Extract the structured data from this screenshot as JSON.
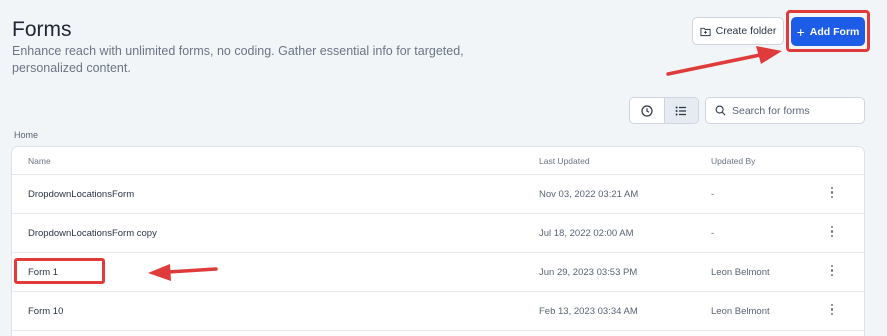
{
  "header": {
    "title": "Forms",
    "subtitle": "Enhance reach with unlimited forms, no coding. Gather essential info for targeted, personalized content.",
    "create_folder_label": "Create folder",
    "add_form_label": "Add Form"
  },
  "toolbar": {
    "search_placeholder": "Search for forms",
    "view_icons": [
      "clock-icon",
      "list-icon"
    ]
  },
  "breadcrumb": "Home",
  "table": {
    "columns": [
      "Name",
      "Last Updated",
      "Updated By"
    ],
    "rows": [
      {
        "name": "DropdownLocationsForm",
        "last_updated": "Nov 03, 2022 03:21 AM",
        "updated_by": "-"
      },
      {
        "name": "DropdownLocationsForm copy",
        "last_updated": "Jul 18, 2022 02:00 AM",
        "updated_by": "-"
      },
      {
        "name": "Form 1",
        "last_updated": "Jun 29, 2023 03:53 PM",
        "updated_by": "Leon Belmont"
      },
      {
        "name": "Form 10",
        "last_updated": "Feb 13, 2023 03:34 AM",
        "updated_by": "Leon Belmont"
      }
    ]
  },
  "colors": {
    "accent": "#1c5ce6",
    "highlight": "#e03b3b",
    "background": "#f2f5f8"
  }
}
